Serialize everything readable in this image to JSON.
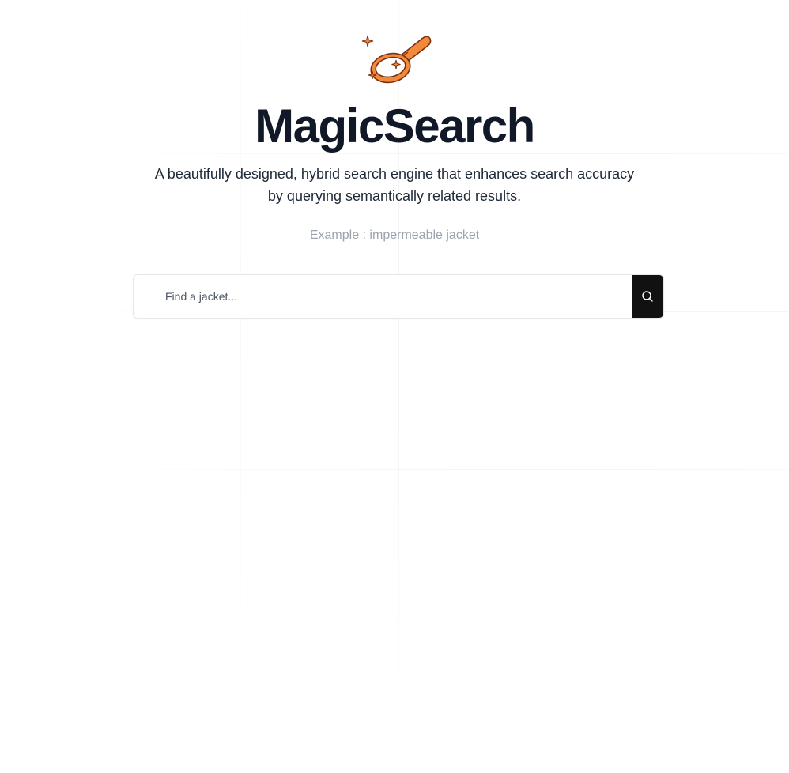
{
  "app": {
    "title": "MagicSearch",
    "tagline": "A beautifully designed, hybrid search engine that enhances search accuracy by querying semantically related results.",
    "example": "Example : impermeable jacket",
    "logo_icon": "magnifying-glass-sparkles-icon"
  },
  "search": {
    "placeholder": "Find a jacket...",
    "value": "",
    "button_icon": "search-icon"
  },
  "colors": {
    "accent": "#f28a3a",
    "accent_outline": "#7a2e12",
    "title": "#111827",
    "button_bg": "#111111"
  }
}
